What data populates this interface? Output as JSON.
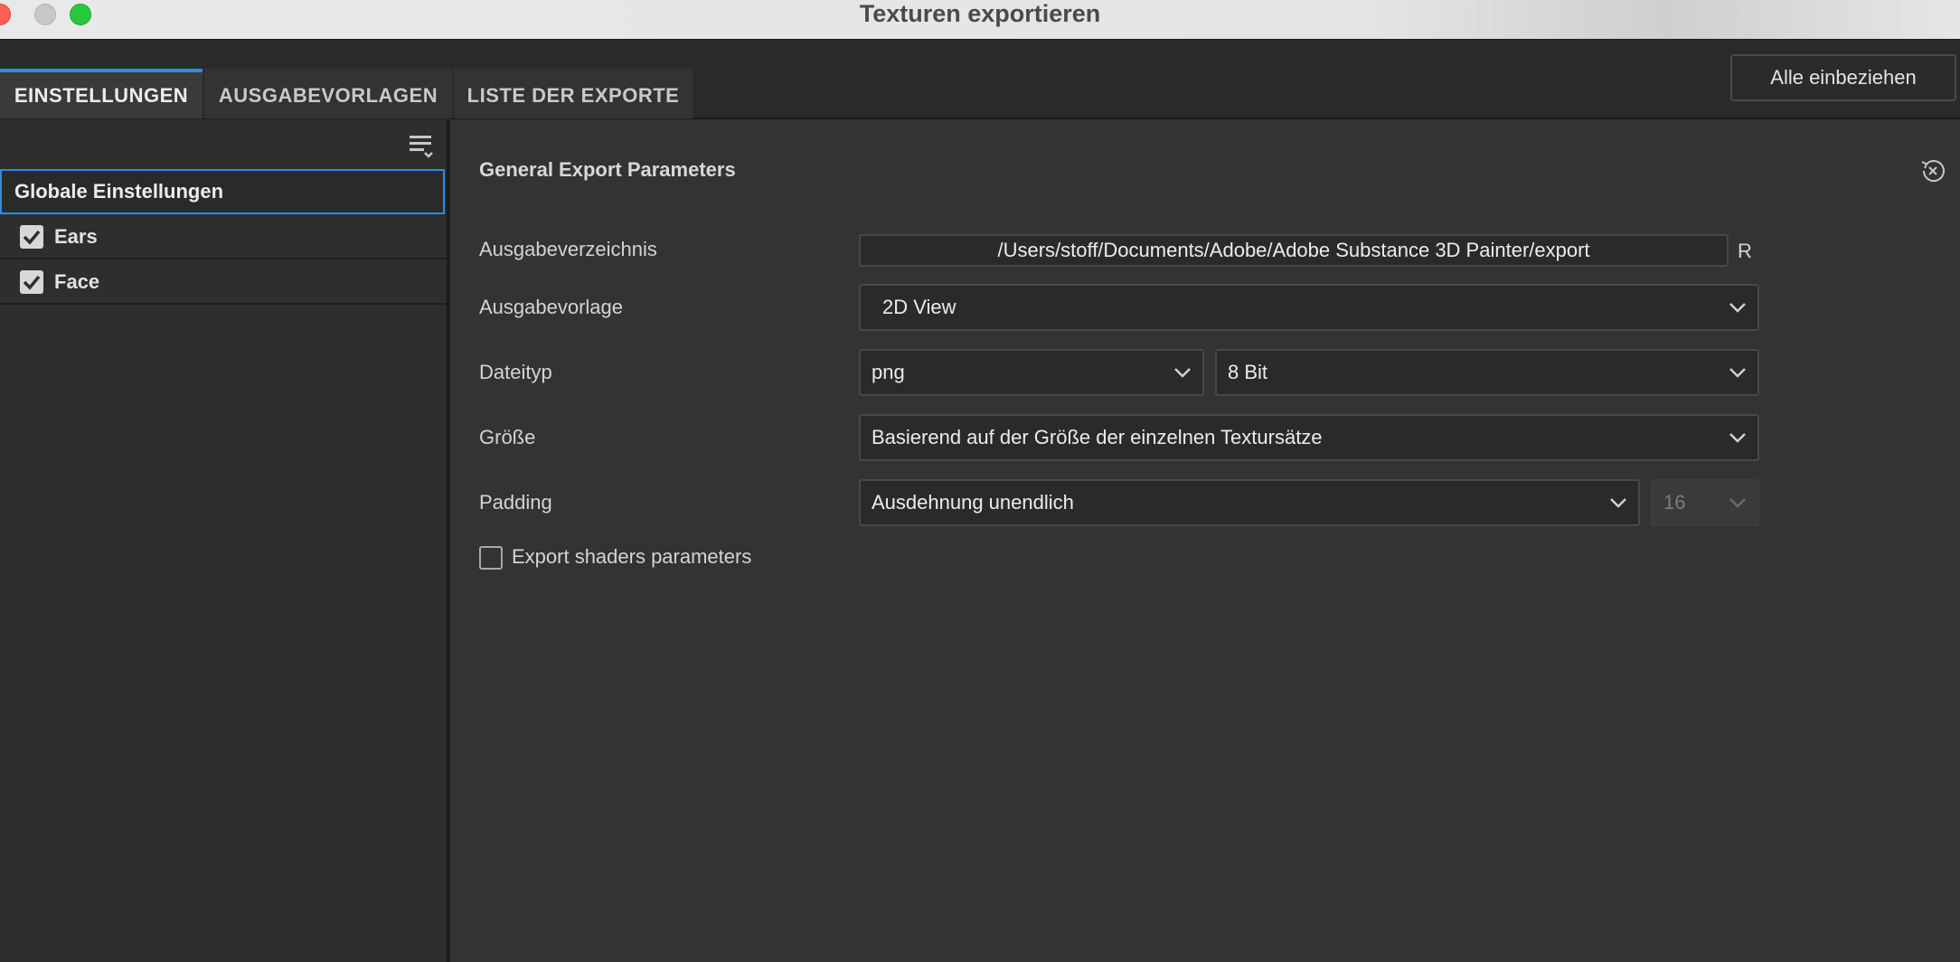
{
  "window": {
    "title": "Texturen exportieren"
  },
  "tabs": [
    {
      "label": "EINSTELLUNGEN",
      "active": true
    },
    {
      "label": "AUSGABEVORLAGEN",
      "active": false
    },
    {
      "label": "LISTE DER EXPORTE",
      "active": false
    }
  ],
  "toolbar": {
    "include_all_label": "Alle einbeziehen"
  },
  "sidebar": {
    "global_label": "Globale Einstellungen",
    "texture_sets": [
      {
        "label": "Ears",
        "checked": true
      },
      {
        "label": "Face",
        "checked": true
      }
    ]
  },
  "main": {
    "section_title": "General Export Parameters",
    "output_dir": {
      "label": "Ausgabeverzeichnis",
      "value": "/Users/stoff/Documents/Adobe/Adobe Substance 3D Painter/export",
      "suffix": "R"
    },
    "output_template": {
      "label": "Ausgabevorlage",
      "value": "2D View"
    },
    "file_type": {
      "label": "Dateityp",
      "format": "png",
      "bit_depth": "8 Bit"
    },
    "size": {
      "label": "Größe",
      "value": "Basierend auf der Größe der einzelnen Textursätze"
    },
    "padding": {
      "label": "Padding",
      "mode": "Ausdehnung unendlich",
      "dilation": "16"
    },
    "export_shaders": {
      "label": "Export shaders parameters",
      "checked": false
    }
  },
  "colors": {
    "accent": "#2d8ce3",
    "background": "#333333",
    "panel": "#2e2e2e"
  }
}
